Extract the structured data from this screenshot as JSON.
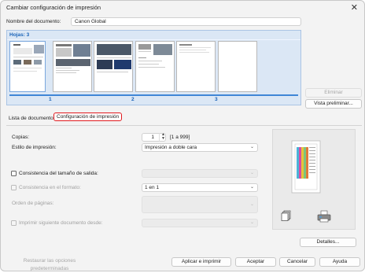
{
  "window": {
    "title": "Cambiar configuración de impresión",
    "close_glyph": "✕"
  },
  "document_name": {
    "label": "Nombre del documento:",
    "value": "Canon Global"
  },
  "preview": {
    "header": "Hojas: 3",
    "page_numbers": [
      "1",
      "2",
      "3"
    ]
  },
  "side_buttons": {
    "delete": "Eliminar",
    "preview": "Vista preliminar..."
  },
  "tabs": [
    {
      "label": "Lista de documentos"
    },
    {
      "label": "Configuración de impresión"
    }
  ],
  "settings": {
    "copies_label": "Copias:",
    "copies_value": "1",
    "copies_range": "[1 a 999]",
    "print_style_label": "Estilo de impresión:",
    "print_style_value": "Impresión a doble cara",
    "output_size_label": "Consistencia del tamaño de salida:",
    "format_label": "Consistencia en el formato:",
    "format_value": "1 en 1",
    "page_order_label": "Orden de páginas:",
    "print_next_label": "Imprimir siguiente documento desde:"
  },
  "details_button": "Detalles...",
  "footer": {
    "restore": "Restaurar las opciones predeterminadas",
    "apply_print": "Aplicar e imprimir",
    "ok": "Aceptar",
    "cancel": "Cancelar",
    "help": "Ayuda"
  },
  "colors": {
    "accent": "#3f86d6",
    "tab_highlight": "#e0191e",
    "preview_bg": "#dbe7f5"
  },
  "icons": [
    "close-icon",
    "chevron-down-icon",
    "spin-up-icon",
    "spin-down-icon",
    "stack-icon",
    "printer-icon"
  ]
}
